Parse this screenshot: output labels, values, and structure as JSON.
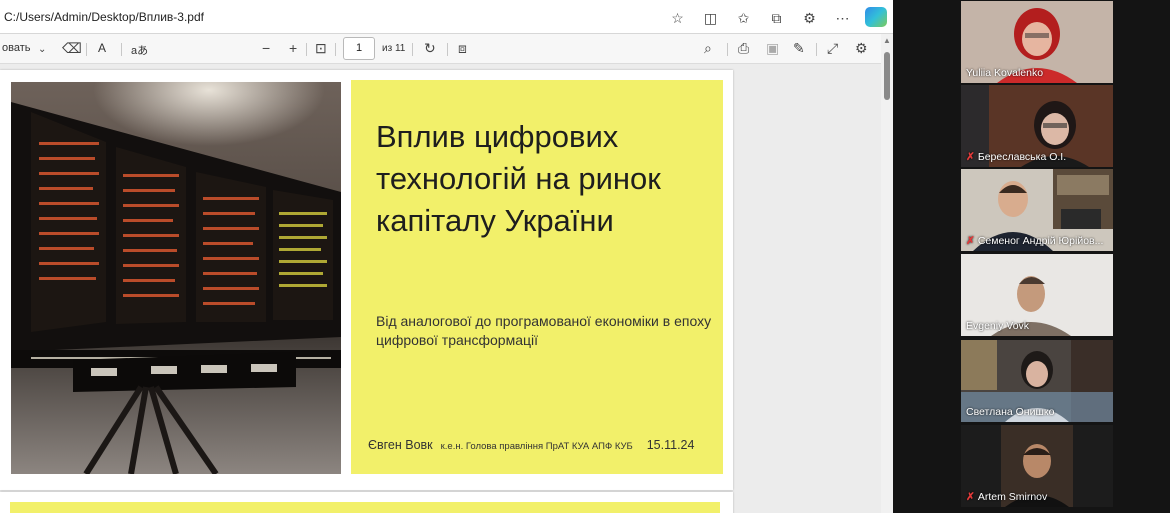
{
  "browser": {
    "url": "C:/Users/Admin/Desktop/Вплив-3.pdf",
    "address_icons": [
      "reader-view-icon",
      "favorite-icon",
      "favorites-list-icon",
      "collections-icon",
      "extensions-icon",
      "more-icon",
      "copilot-icon"
    ]
  },
  "pdf_toolbar": {
    "draw_label": "овать",
    "read_aloud_label": "A",
    "translate_label": "aあ",
    "zoom_out": "−",
    "zoom_in": "+",
    "current_page": "1",
    "page_total": "из 11"
  },
  "slide": {
    "title": "Вплив цифрових технологій на ринок капіталу України",
    "subtitle": "Від аналогової до програмованої економіки в епоху цифрової трансформації",
    "author": "Євген Вовк",
    "position": "к.е.н. Голова правління ПрАТ КУА АПФ КУБ",
    "date": "15.11.24"
  },
  "participants": [
    {
      "name": "Yuliia Kovalenko",
      "muted": false,
      "active": false
    },
    {
      "name": "Береславська О.І.",
      "muted": true,
      "active": false
    },
    {
      "name": "Семеног Андрій Юрійов...",
      "muted": true,
      "active": false
    },
    {
      "name": "Evgeniy Vovk",
      "muted": false,
      "active": true
    },
    {
      "name": "Светлана Онишко",
      "muted": false,
      "active": false
    },
    {
      "name": "Artem Smirnov",
      "muted": true,
      "active": false
    }
  ],
  "colors": {
    "slide_bg": "#f2f06a",
    "active_speaker_border": "#3fca6b",
    "mute_icon": "#e23a3a"
  }
}
